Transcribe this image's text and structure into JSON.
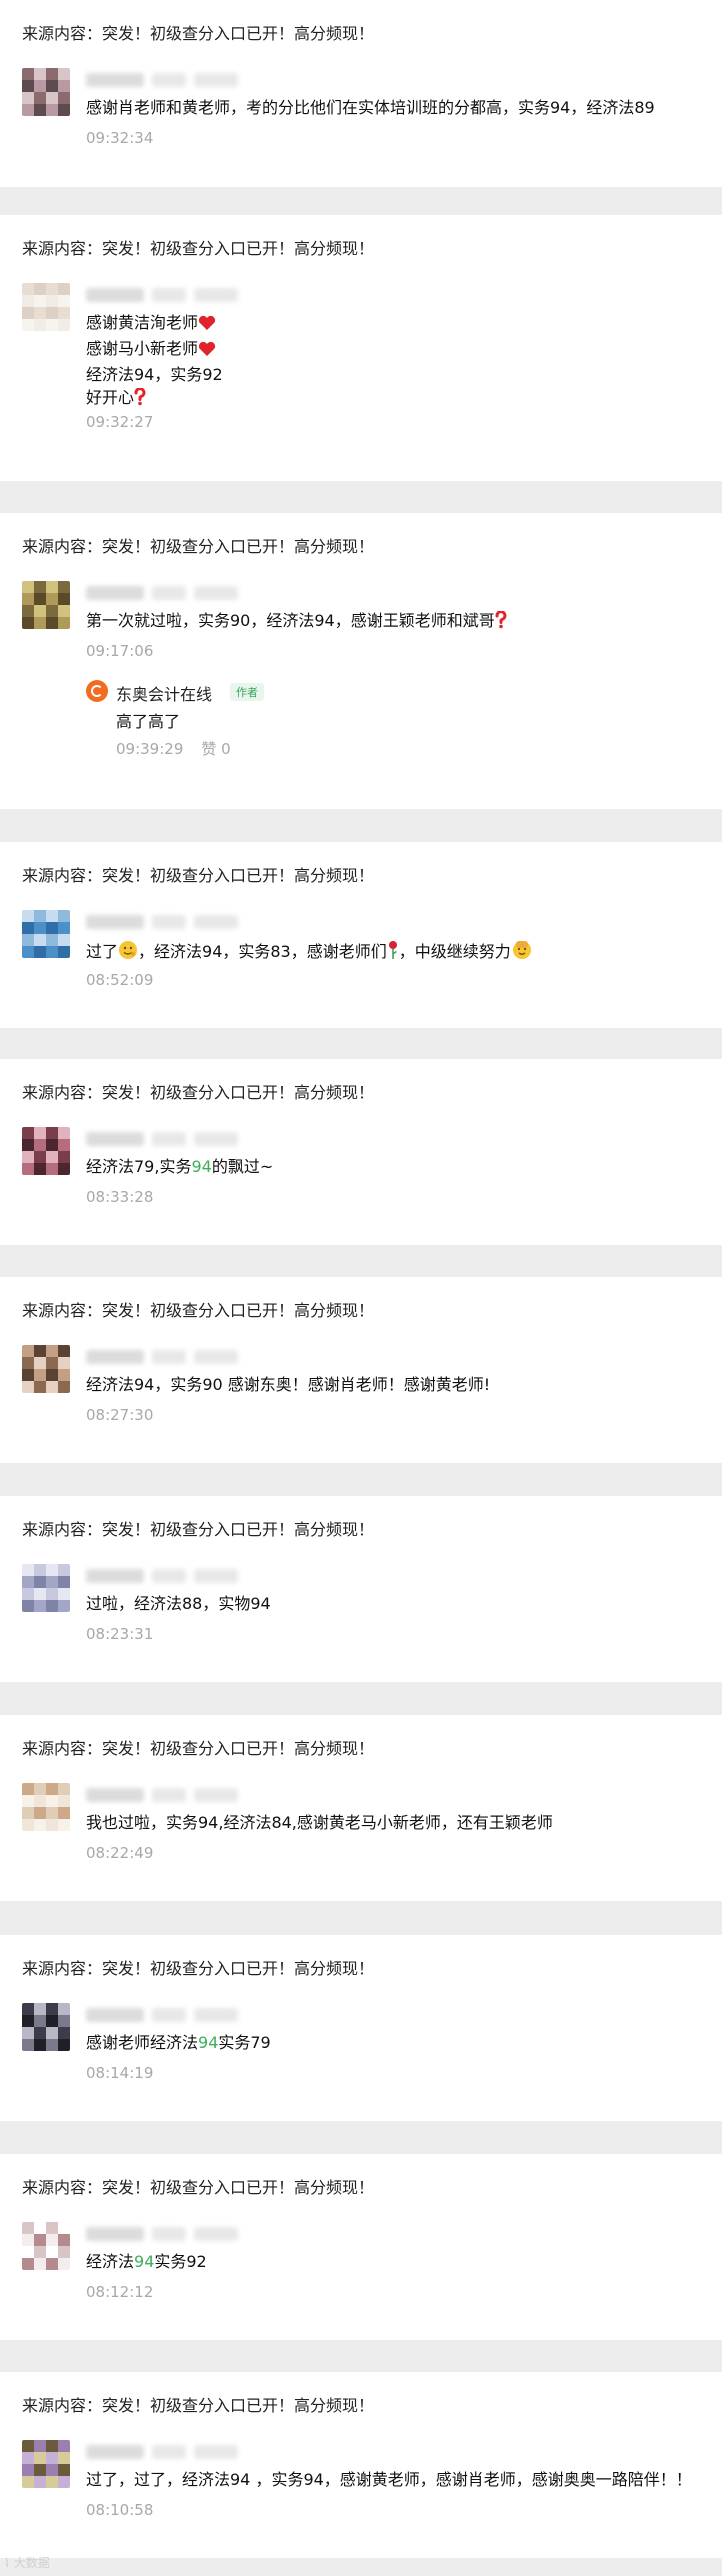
{
  "source_label": "来源内容：突发！初级查分入口已开！高分频现！",
  "comments": [
    {
      "lines": [
        [
          {
            "t": "感谢肖老师和黄老师，考的分比他们在实体培训班的分都高，实务94，经济法89"
          }
        ]
      ],
      "time": "09:32:34"
    },
    {
      "lines": [
        [
          {
            "t": "感谢黄洁洵老师"
          },
          {
            "emo": "heart"
          }
        ],
        [
          {
            "t": "感谢马小新老师"
          },
          {
            "emo": "heart"
          }
        ],
        [
          {
            "t": "经济法94，实务92"
          }
        ],
        [
          {
            "t": "好开心"
          },
          {
            "emo": "question"
          }
        ]
      ],
      "time": "09:32:27"
    },
    {
      "lines": [
        [
          {
            "t": "第一次就过啦，实务90，经济法94，感谢王颖老师和斌哥"
          },
          {
            "emo": "question"
          }
        ]
      ],
      "time": "09:17:06",
      "reply": {
        "author": "东奥会计在线",
        "badge": "作者",
        "text": "高了高了",
        "time": "09:39:29",
        "likes": "赞 0"
      }
    },
    {
      "lines": [
        [
          {
            "t": "过了"
          },
          {
            "emo": "face"
          },
          {
            "t": "，经济法94，实务83，感谢老师们"
          },
          {
            "emo": "rose"
          },
          {
            "t": "，中级继续努力"
          },
          {
            "emo": "fist"
          }
        ]
      ],
      "time": "08:52:09"
    },
    {
      "lines": [
        [
          {
            "t": "经济法79,实务"
          },
          {
            "t": "94",
            "hl": true
          },
          {
            "t": "的飘过~"
          }
        ]
      ],
      "time": "08:33:28"
    },
    {
      "lines": [
        [
          {
            "t": "经济法94，实务90 感谢东奥！感谢肖老师！感谢黄老师!"
          }
        ]
      ],
      "time": "08:27:30"
    },
    {
      "lines": [
        [
          {
            "t": "过啦，经济法88，实物94"
          }
        ]
      ],
      "time": "08:23:31"
    },
    {
      "lines": [
        [
          {
            "t": "我也过啦，实务94,经济法84,感谢黄老马小新老师，还有王颖老师"
          }
        ]
      ],
      "time": "08:22:49"
    },
    {
      "lines": [
        [
          {
            "t": "感谢老师经济法"
          },
          {
            "t": "94",
            "hl": true
          },
          {
            "t": "实务79"
          }
        ]
      ],
      "time": "08:14:19"
    },
    {
      "lines": [
        [
          {
            "t": "经济法"
          },
          {
            "t": "94",
            "hl": true
          },
          {
            "t": "实务92"
          }
        ]
      ],
      "time": "08:12:12"
    },
    {
      "lines": [
        [
          {
            "t": "过了，过了，经济法94 ，实务94，感谢黄老师，感谢肖老师，感谢奥奥一路陪伴！！"
          }
        ]
      ],
      "time": "08:10:58"
    }
  ],
  "watermark": "大数据",
  "colors": {
    "highlight": "#3cb05a",
    "time": "#a8a8a8",
    "background": "#ededed",
    "brand_orange": "#f36b21"
  }
}
